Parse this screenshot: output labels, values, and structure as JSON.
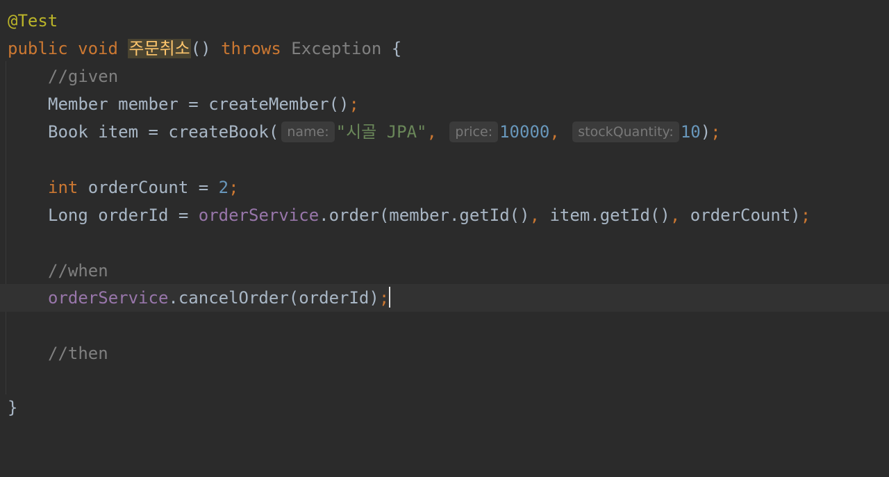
{
  "editor": {
    "annotation": "@Test",
    "signature": {
      "kw_public": "public",
      "kw_void": "void",
      "method_name": "주문취소",
      "parens": "()",
      "kw_throws": "throws",
      "exception": "Exception",
      "open_brace": "{"
    },
    "comment_given": "//given",
    "line_member": {
      "text": "Member member = createMember()",
      "semi": ";"
    },
    "line_book": {
      "prefix": "Book item = createBook(",
      "hint_name": "name:",
      "arg_name": "\"시골 JPA\"",
      "comma1": ",",
      "hint_price": "price:",
      "arg_price": "10000",
      "comma2": ",",
      "hint_stock": "stockQuantity:",
      "arg_stock": "10",
      "close": ")",
      "semi": ";"
    },
    "line_count": {
      "kw_int": "int",
      "text": " orderCount = ",
      "value": "2",
      "semi": ";"
    },
    "line_order": {
      "prefix": "Long orderId = ",
      "field": "orderService",
      "call": ".order(member.getId()",
      "comma1": ",",
      "arg2": " item.getId()",
      "comma2": ",",
      "arg3": " orderCount)",
      "semi": ";"
    },
    "comment_when": "//when",
    "line_cancel": {
      "field": "orderService",
      "call": ".cancelOrder(orderId)",
      "semi": ";"
    },
    "comment_then": "//then",
    "close_brace": "}"
  }
}
